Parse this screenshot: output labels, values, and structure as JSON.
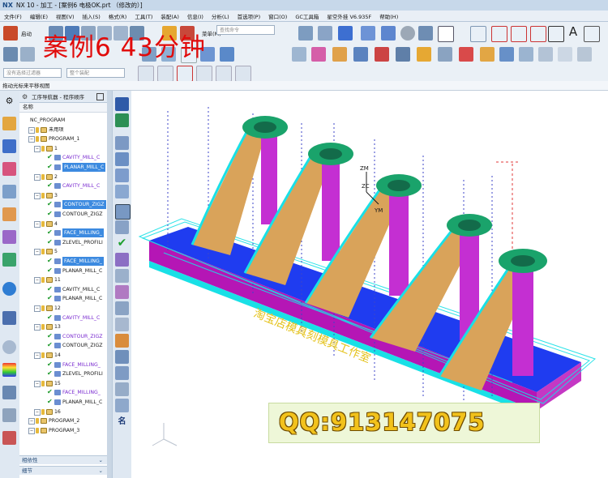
{
  "window": {
    "logo": "NX",
    "title": "NX 10 - 加工 - [案例6 电极OK.prt （修改的）]"
  },
  "menu": [
    "文件(F)",
    "编辑(E)",
    "视图(V)",
    "插入(S)",
    "格式(R)",
    "工具(T)",
    "装配(A)",
    "信息(I)",
    "分析(L)",
    "首选项(P)",
    "窗口(O)",
    "GC工具箱",
    "星空外挂 V6.935F",
    "帮助(H)"
  ],
  "toolbar": {
    "start_label": "启动",
    "combo_filter": "没有选择过滤器",
    "combo_assembly": "整个装配",
    "menu_label": "菜单(M)",
    "combo_command": "查找命令"
  },
  "overlay_title": "案例6   43分钟",
  "statusline": "拖动光标来平移视图",
  "navigator": {
    "title": "工序导航器 - 程序顺序",
    "column": "名称",
    "rows": [
      {
        "level": 0,
        "label": "NC_PROGRAM",
        "icon": "none"
      },
      {
        "level": 1,
        "label": "未用项",
        "icon": "folder"
      },
      {
        "level": 1,
        "label": "PROGRAM_1",
        "icon": "folder"
      },
      {
        "level": 2,
        "label": "1",
        "icon": "folder"
      },
      {
        "level": 3,
        "label": "CAVITY_MILL_C",
        "icon": "op",
        "style": "purple"
      },
      {
        "level": 3,
        "label": "PLANAR_MILL_C",
        "icon": "op",
        "style": "selected"
      },
      {
        "level": 2,
        "label": "2",
        "icon": "folder"
      },
      {
        "level": 3,
        "label": "CAVITY_MILL_C",
        "icon": "op",
        "style": "purple"
      },
      {
        "level": 2,
        "label": "3",
        "icon": "folder"
      },
      {
        "level": 3,
        "label": "CONTOUR_ZIGZ",
        "icon": "op",
        "style": "selected"
      },
      {
        "level": 3,
        "label": "CONTOUR_ZIGZ",
        "icon": "op",
        "style": "normal"
      },
      {
        "level": 2,
        "label": "4",
        "icon": "folder"
      },
      {
        "level": 3,
        "label": "FACE_MILLING_",
        "icon": "op",
        "style": "selected"
      },
      {
        "level": 3,
        "label": "ZLEVEL_PROFILI",
        "icon": "op",
        "style": "normal"
      },
      {
        "level": 2,
        "label": "5",
        "icon": "folder"
      },
      {
        "level": 3,
        "label": "FACE_MILLING_",
        "icon": "op",
        "style": "selected"
      },
      {
        "level": 3,
        "label": "PLANAR_MILL_C",
        "icon": "op",
        "style": "normal"
      },
      {
        "level": 2,
        "label": "11",
        "icon": "folder"
      },
      {
        "level": 3,
        "label": "CAVITY_MILL_C",
        "icon": "op",
        "style": "normal"
      },
      {
        "level": 3,
        "label": "PLANAR_MILL_C",
        "icon": "op",
        "style": "normal"
      },
      {
        "level": 2,
        "label": "12",
        "icon": "folder"
      },
      {
        "level": 3,
        "label": "CAVITY_MILL_C",
        "icon": "op",
        "style": "purple"
      },
      {
        "level": 2,
        "label": "13",
        "icon": "folder"
      },
      {
        "level": 3,
        "label": "CONTOUR_ZIGZ",
        "icon": "op",
        "style": "purple"
      },
      {
        "level": 3,
        "label": "CONTOUR_ZIGZ",
        "icon": "op",
        "style": "normal"
      },
      {
        "level": 2,
        "label": "14",
        "icon": "folder"
      },
      {
        "level": 3,
        "label": "FACE_MILLING_",
        "icon": "op",
        "style": "purple"
      },
      {
        "level": 3,
        "label": "ZLEVEL_PROFILI",
        "icon": "op",
        "style": "normal"
      },
      {
        "level": 2,
        "label": "15",
        "icon": "folder"
      },
      {
        "level": 3,
        "label": "FACE_MILLING_",
        "icon": "op",
        "style": "purple"
      },
      {
        "level": 3,
        "label": "PLANAR_MILL_C",
        "icon": "op",
        "style": "normal"
      },
      {
        "level": 2,
        "label": "16",
        "icon": "folder"
      },
      {
        "level": 1,
        "label": "PROGRAM_2",
        "icon": "folder"
      },
      {
        "level": 1,
        "label": "PROGRAM_3",
        "icon": "folder"
      }
    ],
    "footer": [
      "相依性",
      "细节"
    ]
  },
  "viewport": {
    "engraving_text": "淘宝店模具刻模具工作室",
    "axis_zm": "ZM",
    "axis_zc": "ZC",
    "axis_ym": "YM"
  },
  "qq_banner": "QQ:913147075",
  "colors": {
    "accent_red": "#e10b0b",
    "base_blue": "#1f3cf0",
    "base_magenta": "#b516b5",
    "rib_tan": "#d9a35a",
    "cylinder_magenta": "#c42fd2",
    "toolpath_cyan": "#19e0e6",
    "selection_blue": "#3c8ae0"
  }
}
